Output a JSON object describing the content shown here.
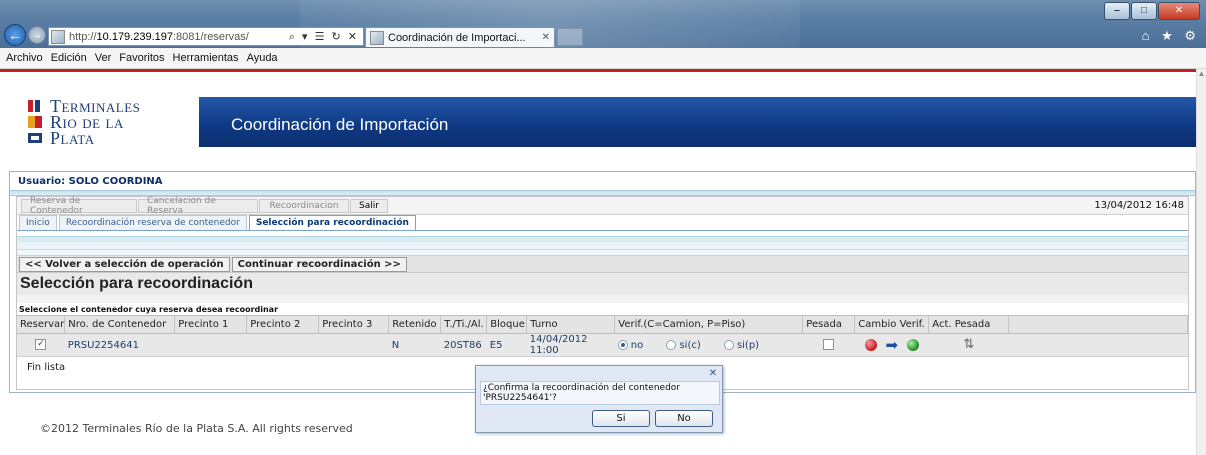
{
  "browser": {
    "url_prefix": "http://",
    "url_host": "10.179.239.197",
    "url_path": ":8081/reservas/",
    "addr_tools": "⌕ ▾ ☰ ↻ ✕",
    "tab_title": "Coordinación de Importaci...",
    "tab_close": "✕",
    "right_icons": "⌂ ★ ⚙",
    "back_glyph": "←",
    "fwd_glyph": "→",
    "win_min": "–",
    "win_max": "□",
    "win_close": "✕"
  },
  "menu": [
    "Archivo",
    "Edición",
    "Ver",
    "Favoritos",
    "Herramientas",
    "Ayuda"
  ],
  "logo": {
    "line1": "Terminales",
    "line2": "Rio de la",
    "line3": "Plata"
  },
  "banner": {
    "title": "Coordinación de Importación"
  },
  "user": {
    "label": "Usuario: SOLO COORDINA"
  },
  "toolbar": {
    "items": [
      "Reserva de Contenedor",
      "Cancelacion de Reserva",
      "Recoordinacion",
      "Salir"
    ],
    "datetime": "13/04/2012 16:48"
  },
  "tabs": [
    "Inicio",
    "Recoordinación reserva de contenedor",
    "Selección para recoordinación"
  ],
  "nav": {
    "back": "<< Volver a selección de operación",
    "next": "Continuar recoordinación >>"
  },
  "section": {
    "title": "Selección para recoordinación",
    "instruction": "Seleccione el contenedor cuya reserva desea recoordinar"
  },
  "table": {
    "headers": [
      "Reservar",
      "Nro. de Contenedor",
      "Precinto 1",
      "Precinto 2",
      "Precinto 3",
      "Retenido",
      "T./Ti./Al.",
      "Bloque",
      "Turno",
      "Verif.(C=Camion, P=Piso)",
      "Pesada",
      "Cambio Verif.",
      "Act. Pesada"
    ],
    "row": {
      "reservar_checked": true,
      "container": "PRSU2254641",
      "precinto1": "",
      "precinto2": "",
      "precinto3": "",
      "retenido": "N",
      "tipo": "20ST86",
      "bloque": "E5",
      "turno": "14/04/2012 11:00",
      "verif_options": [
        "no",
        "si(c)",
        "si(p)"
      ],
      "verif_selected": "no",
      "pesada_checked": false,
      "cambio_icons": [
        "red-dot-icon",
        "blue-arrow-icon",
        "green-dot-icon"
      ],
      "act_pesada_icon": "refresh-icon"
    },
    "end_label": "Fin lista"
  },
  "dialog": {
    "message": "¿Confirma la recoordinación del contenedor 'PRSU2254641'?",
    "yes": "Si",
    "no": "No",
    "close": "✕"
  },
  "footer": {
    "copyright": "©2012 Terminales Río de la Plata S.A. All rights reserved"
  },
  "colors": {
    "banner": "#0f3a86",
    "accent_red": "#c0202a",
    "dialog_bg": "#dfe8f4"
  }
}
